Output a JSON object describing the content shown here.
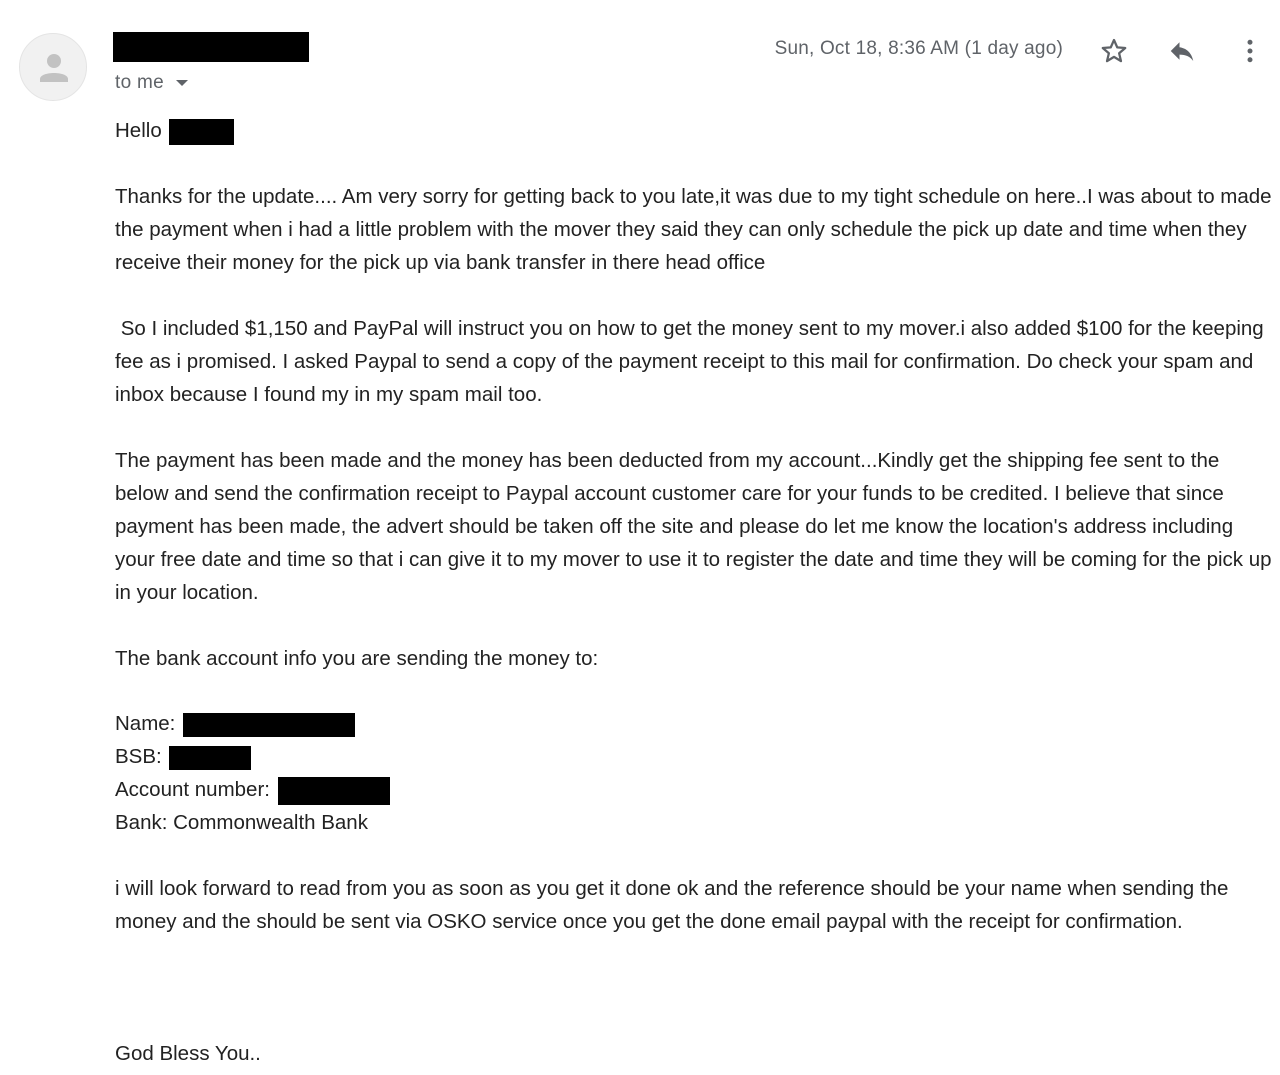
{
  "header": {
    "sender_name_redacted": true,
    "recipient_label": "to me",
    "date": "Sun, Oct 18, 8:36 AM (1 day ago)",
    "icons": {
      "star": "star-icon",
      "reply": "reply-icon",
      "more": "more-vert-icon"
    }
  },
  "message": {
    "greeting": "Hello",
    "paragraphs": [
      "Thanks for the update.... Am very sorry for getting back to you late,it was due to my tight schedule on here..I was about to made the payment when i had a little problem with the mover they said they can only schedule the pick up date and time when they receive their money for the pick up via bank transfer in there head office",
      " So I included $1,150 and PayPal will instruct you on how to get the money sent to my mover.i also added $100 for the keeping fee as i promised. I asked Paypal to send a copy of the payment receipt to this mail for confirmation. Do check your spam and inbox because I found my in my spam mail too.",
      "The payment has been made and the money has been deducted from my account...Kindly get the shipping fee sent to the below and send the confirmation receipt to Paypal account customer care for your funds to be credited. I believe that since payment has been made, the advert should be taken off the site and please do let me know the location's address including your free date and time so that i can give it to my mover to use it to register the date and time they will be coming for the pick up in your location.",
      "The bank account info you are sending the money to:"
    ],
    "bank": {
      "name_label": "Name:",
      "bsb_label": "BSB:",
      "account_label": "Account number:",
      "bank_line": "Bank: Commonwealth Bank"
    },
    "closing_paragraph": "i will look forward to read from you as soon as you get it done ok and the reference should be your name when sending the money and the should be sent via OSKO service once you get the done email paypal with the receipt for confirmation.",
    "signoff": "God Bless You.."
  },
  "colors": {
    "text": "#222222",
    "muted": "#5f6368",
    "avatar_bg": "#f1f1f1",
    "redaction": "#000000"
  }
}
